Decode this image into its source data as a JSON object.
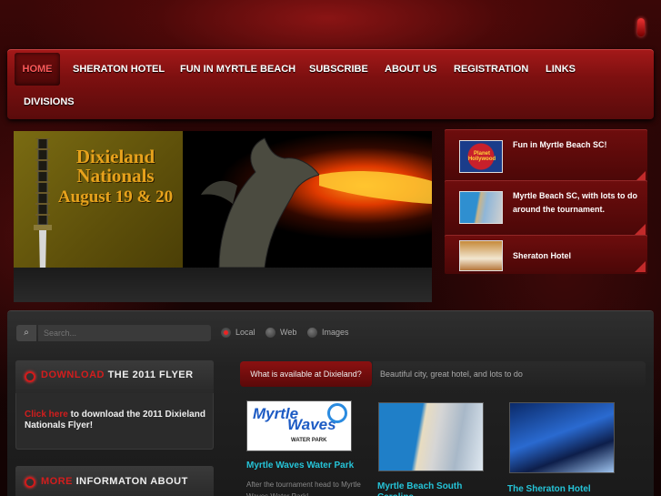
{
  "nav": {
    "items": [
      {
        "label": "HOME",
        "active": true
      },
      {
        "label": "SHERATON HOTEL"
      },
      {
        "label": "FUN IN MYRTLE BEACH"
      },
      {
        "label": "SUBSCRIBE"
      },
      {
        "label": "ABOUT US"
      },
      {
        "label": "REGISTRATION"
      },
      {
        "label": "LINKS"
      },
      {
        "label": "DIVISIONS"
      }
    ]
  },
  "slideshow": {
    "title": "Dixieland Nationals",
    "date": "August 19 & 20"
  },
  "features": [
    {
      "text": "Fun in Myrtle Beach SC!",
      "thumb_text": "Planet Hollywood"
    },
    {
      "text": "Myrtle Beach SC, with lots to do around the tournament."
    },
    {
      "text": "Sheraton Hotel"
    }
  ],
  "search": {
    "placeholder": "Search...",
    "options": [
      {
        "label": "Local",
        "selected": true
      },
      {
        "label": "Web"
      },
      {
        "label": "Images"
      }
    ]
  },
  "modules": {
    "flyer": {
      "title_red": "DOWNLOAD",
      "title_rest": "THE 2011 FLYER",
      "link": "Click here",
      "text": "to download the 2011 Dixieland Nationals Flyer!"
    },
    "more": {
      "title_red": "MORE",
      "title_rest": "INFORMATON ABOUT"
    }
  },
  "tabs": {
    "active": "What is available at Dixieland?",
    "inactive": "Beautiful city, great hotel, and lots to do"
  },
  "articles": [
    {
      "title": "Myrtle Waves Water Park",
      "text": "After the tournament head to Myrtle Waves Water Park!",
      "logo_line1": "Myrtle",
      "logo_line2": "Waves",
      "logo_sub": "WATER PARK"
    },
    {
      "title": "Myrtle Beach South Carolina"
    },
    {
      "title": "The Sheraton Hotel"
    }
  ],
  "colors": {
    "accent_red": "#d31d1d",
    "link_cyan": "#25c4d8"
  }
}
